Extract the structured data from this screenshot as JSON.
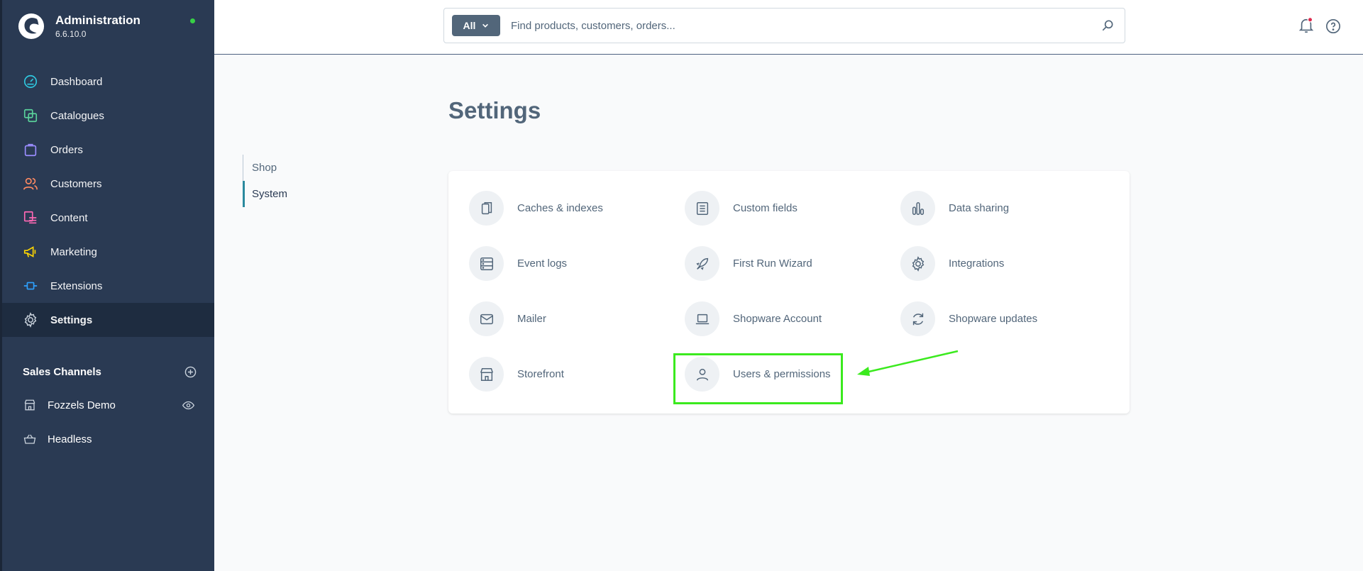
{
  "app": {
    "title": "Administration",
    "version": "6.6.10.0",
    "status_color": "#37d046"
  },
  "sidebar": {
    "items": [
      {
        "label": "Dashboard",
        "icon": "dashboard-gauge-icon",
        "color": "#2fc8e0"
      },
      {
        "label": "Catalogues",
        "icon": "catalogues-icon",
        "color": "#5ad29b"
      },
      {
        "label": "Orders",
        "icon": "orders-bag-icon",
        "color": "#9b8dff"
      },
      {
        "label": "Customers",
        "icon": "customers-icon",
        "color": "#ff8a62"
      },
      {
        "label": "Content",
        "icon": "content-icon",
        "color": "#ff68b4"
      },
      {
        "label": "Marketing",
        "icon": "marketing-megaphone-icon",
        "color": "#ffd700"
      },
      {
        "label": "Extensions",
        "icon": "extensions-plug-icon",
        "color": "#2ea1ff"
      },
      {
        "label": "Settings",
        "icon": "settings-gear-icon",
        "color": "#ffffff"
      }
    ],
    "active": "Settings",
    "sales_channels": {
      "title": "Sales Channels",
      "items": [
        {
          "label": "Fozzels Demo",
          "icon": "storefront-icon"
        },
        {
          "label": "Headless",
          "icon": "basket-icon"
        }
      ]
    }
  },
  "header": {
    "search": {
      "type_label": "All",
      "placeholder": "Find products, customers, orders..."
    },
    "notification_badge_color": "#de294c"
  },
  "page": {
    "title": "Settings",
    "tabs": [
      {
        "label": "Shop"
      },
      {
        "label": "System"
      }
    ],
    "active_tab": "System",
    "settings": [
      {
        "label": "Caches & indexes",
        "icon": "caches-icon"
      },
      {
        "label": "Custom fields",
        "icon": "custom-fields-icon"
      },
      {
        "label": "Data sharing",
        "icon": "data-sharing-chart-icon"
      },
      {
        "label": "Event logs",
        "icon": "event-logs-icon"
      },
      {
        "label": "First Run Wizard",
        "icon": "rocket-icon"
      },
      {
        "label": "Integrations",
        "icon": "integrations-gear-icon"
      },
      {
        "label": "Mailer",
        "icon": "envelope-icon"
      },
      {
        "label": "Shopware Account",
        "icon": "laptop-icon"
      },
      {
        "label": "Shopware updates",
        "icon": "refresh-icon"
      },
      {
        "label": "Storefront",
        "icon": "storefront-icon"
      },
      {
        "label": "Users & permissions",
        "icon": "user-icon"
      }
    ],
    "highlight_color": "#3bea1e"
  }
}
